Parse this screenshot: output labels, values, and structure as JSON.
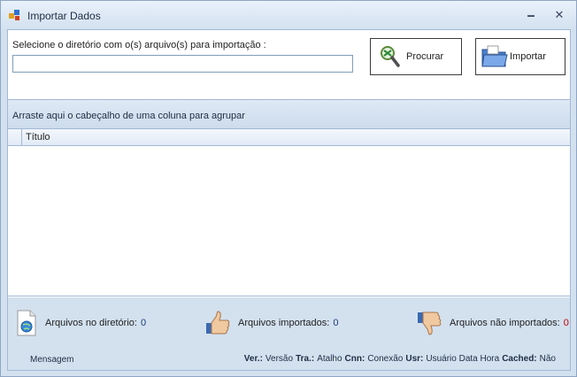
{
  "window": {
    "title": "Importar Dados",
    "minimize_glyph": "🗕",
    "close_glyph": "✕"
  },
  "form": {
    "dir_label": "Selecione o diretório com o(s) arquivo(s) para importação :",
    "dir_value": "",
    "procurar_label": "Procurar",
    "importar_label": "Importar"
  },
  "grid": {
    "group_hint": "Arraste aqui o cabeçalho de uma coluna para agrupar",
    "columns": [
      "Título"
    ],
    "rows": []
  },
  "stats": {
    "no_diretorio_label": "Arquivos no diretório:",
    "no_diretorio_value": "0",
    "importados_label": "Arquivos importados:",
    "importados_value": "0",
    "nao_importados_label": "Arquivos não importados:",
    "nao_importados_value": "0"
  },
  "statusbar": {
    "message": "Mensagem",
    "ver_key": "Ver.:",
    "ver_val": "Versão",
    "tra_key": "Tra.:",
    "tra_val": "Atalho",
    "cnn_key": "Cnn:",
    "cnn_val": "Conexão",
    "usr_key": "Usr:",
    "usr_val": "Usuário Data Hora",
    "cached_key": "Cached:",
    "cached_val": "Não"
  },
  "icons": {
    "app": "app-icon",
    "procurar": "magnifier-icon",
    "importar": "folder-icon",
    "no_diretorio": "document-globe-icon",
    "importados": "thumbs-up-icon",
    "nao_importados": "thumbs-down-icon"
  },
  "colors": {
    "chrome": "#d3e1ef",
    "border": "#a3b8d3",
    "value_ok": "#1a3e7a",
    "value_error": "#c00000"
  }
}
